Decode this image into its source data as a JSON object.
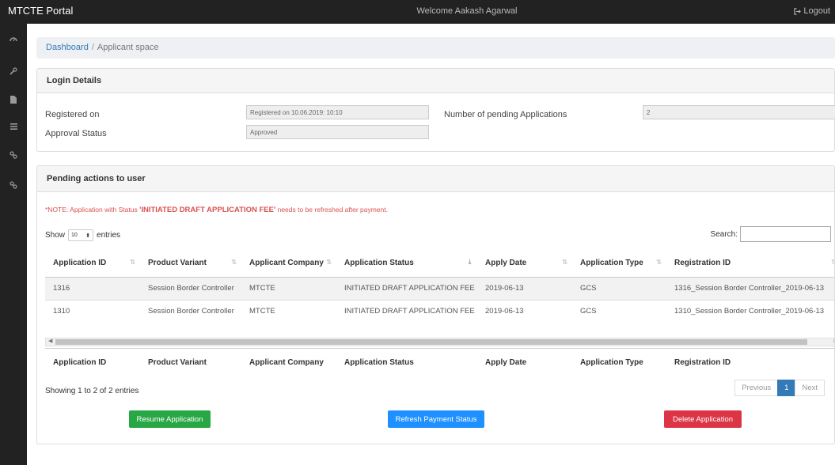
{
  "app": {
    "title": "MTCTE Portal",
    "welcome": "Welcome Aakash Agarwal",
    "logout_label": "Logout"
  },
  "sidebar": {
    "items": [
      "dashboard-icon",
      "wrench-icon",
      "file-icon",
      "list-icon",
      "link-icon",
      "link-icon"
    ]
  },
  "breadcrumb": {
    "home": "Dashboard",
    "separator": "/",
    "current": "Applicant space"
  },
  "login_details": {
    "heading": "Login Details",
    "registered_label": "Registered on",
    "registered_value": "Registered on 10.06.2019: 10:10",
    "approval_label": "Approval Status",
    "approval_value": "Approved",
    "pending_label": "Number of pending Applications",
    "pending_value": "2"
  },
  "pending": {
    "heading": "Pending actions to user",
    "note_prefix": "*NOTE: Application with Status ",
    "note_status": "'INITIATED DRAFT APPLICATION FEE'",
    "note_suffix": " needs to be refreshed after payment.",
    "show_label": "Show",
    "entries_value": "10",
    "entries_label": "entries",
    "search_label": "Search:",
    "columns": [
      "Application ID",
      "Product Variant",
      "Applicant Company",
      "Application Status",
      "Apply Date",
      "Application Type",
      "Registration ID"
    ],
    "rows": [
      [
        "1316",
        "Session Border Controller",
        "MTCTE",
        "INITIATED DRAFT APPLICATION FEE",
        "2019-06-13",
        "GCS",
        "1316_Session Border Controller_2019-06-13"
      ],
      [
        "1310",
        "Session Border Controller",
        "MTCTE",
        "INITIATED DRAFT APPLICATION FEE",
        "2019-06-13",
        "GCS",
        "1310_Session Border Controller_2019-06-13"
      ]
    ],
    "info": "Showing 1 to 2 of 2 entries",
    "pager": {
      "previous": "Previous",
      "page": "1",
      "next": "Next"
    },
    "buttons": {
      "resume": "Resume Application",
      "refresh": "Refresh Payment Status",
      "delete": "Delete Application"
    }
  },
  "colors": {
    "topbar": "#222222",
    "link": "#337ab7",
    "note": "#d9534f",
    "resume": "#28a745",
    "refresh": "#1e90ff",
    "delete": "#dc3545"
  }
}
